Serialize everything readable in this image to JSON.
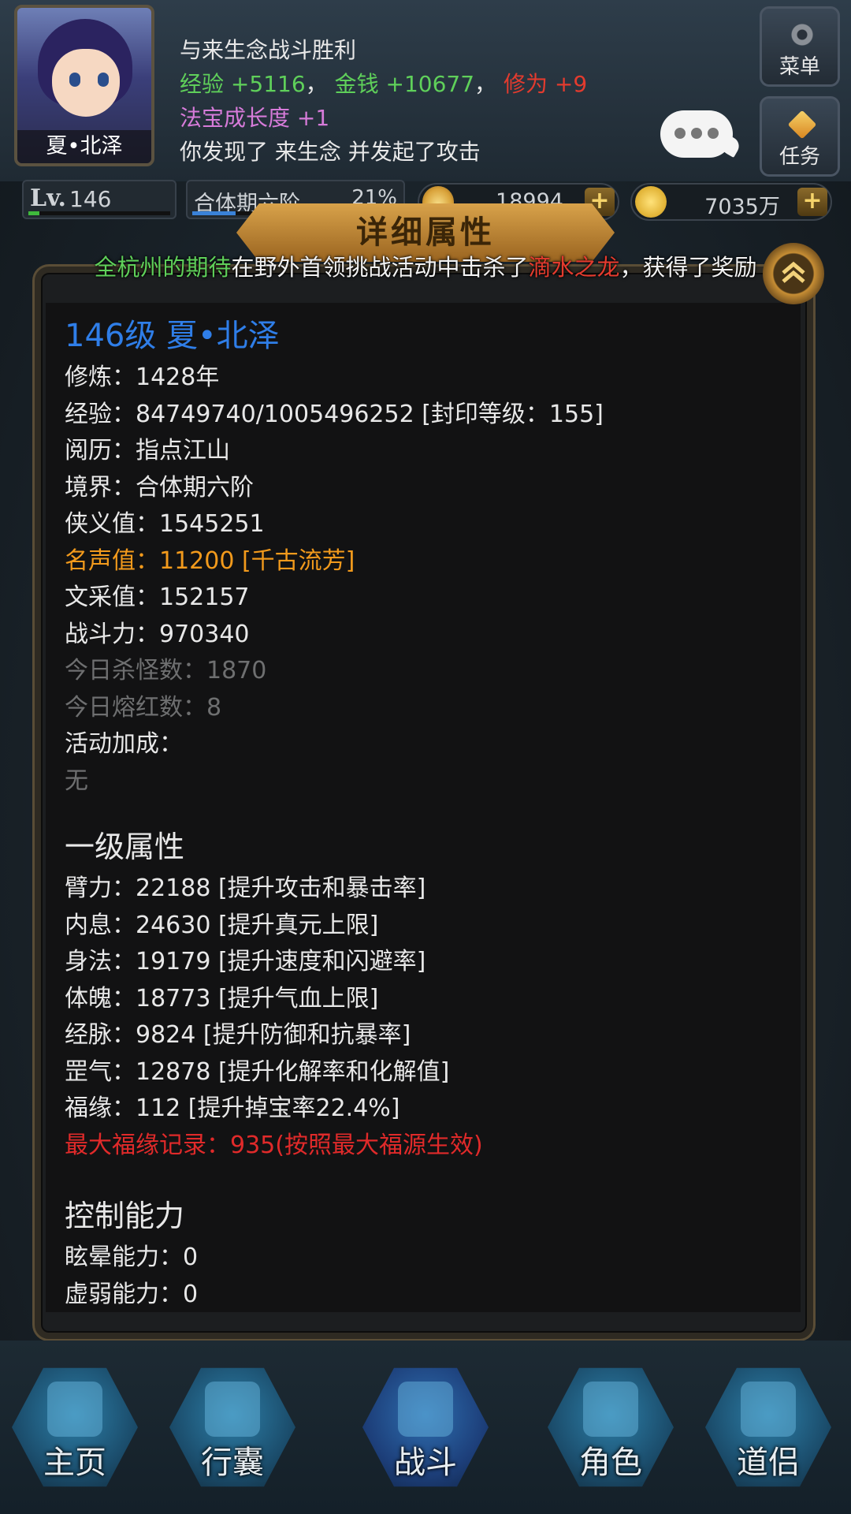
{
  "header": {
    "player_name": "夏•北泽",
    "log": {
      "line1": "与来生念战斗胜利",
      "exp_label": "经验",
      "exp_value": "+5116",
      "sep1": "，",
      "money_label": "金钱",
      "money_value": "+10677",
      "sep2": "，",
      "cultivation_label": "修为",
      "cultivation_value": "+9",
      "growth_label": "法宝成长度",
      "growth_value": "+1",
      "line4": "你发现了 来生念 并发起了攻击"
    },
    "menu_label": "菜单",
    "task_label": "任务"
  },
  "stats": {
    "lv_label": "Lv.",
    "level": "146",
    "level_progress": 0.08,
    "realm": "合体期六阶",
    "realm_percent": "21%",
    "realm_progress": 0.21,
    "ingots": "18994",
    "gold": "7035万"
  },
  "panel": {
    "title": "详细属性",
    "announcement": {
      "player": "全杭州的期待",
      "middle": "在野外首领挑战活动中击杀了",
      "boss": "滴水之龙",
      "end": "，获得了奖励"
    }
  },
  "detail": {
    "hero": "146级 夏•北泽",
    "rows": [
      "修炼：1428年",
      "经验：84749740/1005496252 [封印等级：155]",
      "阅历：指点江山",
      "境界：合体期六阶",
      "侠义值：1545251"
    ],
    "fame": "名声值：11200 [千古流芳]",
    "rows2": [
      "文采值：152157",
      "战斗力：970340"
    ],
    "gray_rows": [
      "今日杀怪数：1870",
      "今日熔红数：8"
    ],
    "bonus_label": "活动加成：",
    "bonus_value": "无",
    "primary_title": "一级属性",
    "primary": [
      "臂力：22188 [提升攻击和暴击率]",
      "内息：24630 [提升真元上限]",
      "身法：19179 [提升速度和闪避率]",
      "体魄：18773 [提升气血上限]",
      "经脉：9824 [提升防御和抗暴率]",
      "罡气：12878 [提升化解率和化解值]",
      "福缘：112 [提升掉宝率22.4%]"
    ],
    "max_luck": "最大福缘记录：935(按照最大福源生效)",
    "control_title": "控制能力",
    "control": [
      "眩晕能力：0",
      "虚弱能力：0"
    ]
  },
  "nav": {
    "home": "主页",
    "bag": "行囊",
    "battle": "战斗",
    "role": "角色",
    "partner": "道侣"
  },
  "colors": {
    "hero_blue": "#2f7ee8",
    "fame_orange": "#f29a1c",
    "warning_red": "#e02a2a",
    "exp_green": "#5fd05a"
  }
}
